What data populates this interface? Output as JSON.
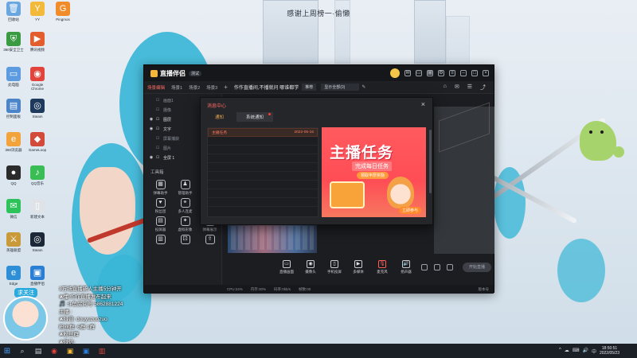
{
  "top_caption": "感谢上周榜一·偷懒",
  "desktop_icons": [
    {
      "label": "回收站",
      "glyph": "🗑",
      "color": "#6aa7e0"
    },
    {
      "label": "YY",
      "glyph": "Y",
      "color": "#f2b93b"
    },
    {
      "label": "Pingmos",
      "glyph": "G",
      "color": "#f28c2b"
    },
    {
      "label": "360安全卫士",
      "glyph": "⛨",
      "color": "#3b9b43"
    },
    {
      "label": "腾讯视频",
      "glyph": "▶",
      "color": "#e45d2f"
    },
    {
      "label": "此电脑",
      "glyph": "▭",
      "color": "#5c9be0"
    },
    {
      "label": "Google Chrome",
      "glyph": "◉",
      "color": "#e2433b"
    },
    {
      "label": "控制面板",
      "glyph": "▤",
      "color": "#4b84c8"
    },
    {
      "label": "Steam",
      "glyph": "◎",
      "color": "#1d3a5c"
    },
    {
      "label": "360浏览器",
      "glyph": "e",
      "color": "#f2a43a"
    },
    {
      "label": "GameLoop",
      "glyph": "◆",
      "color": "#d24a3a"
    },
    {
      "label": "QQ",
      "glyph": "●",
      "color": "#2b2b2b"
    },
    {
      "label": "QQ音乐",
      "glyph": "♪",
      "color": "#3bbd56"
    },
    {
      "label": "微信",
      "glyph": "✉",
      "color": "#2ec35a"
    },
    {
      "label": "新建文本",
      "glyph": "▯",
      "color": "#dfe3e8"
    },
    {
      "label": "英雄联盟",
      "glyph": "⚔",
      "color": "#c89a3a"
    },
    {
      "label": "Steam",
      "glyph": "◎",
      "color": "#1b2838"
    },
    {
      "label": "Edge",
      "glyph": "e",
      "color": "#2f8fd6"
    },
    {
      "label": "直播伴侣",
      "glyph": "▣",
      "color": "#2a7fd4"
    }
  ],
  "overlay": {
    "follow": "求关注",
    "lines": [
      "3万场直播新人主播5分钟开",
      "❀懂:作作直播发布起来",
      "🎵 斗鱼房间号 5862881224",
      "主播 :",
      "❀抖音: douyuzuozuo",
      "粉丝群: 6群 1群",
      "❀粉丝群",
      "❀微信:"
    ]
  },
  "app": {
    "name": "直播伴侣",
    "version": "测试",
    "scene_tabs": [
      "场景编辑",
      "场景1",
      "场景2",
      "场景3"
    ],
    "notice": "作作直播间,不播就问 哪谁都学",
    "tag": "推荐",
    "tag2": "显示全部(0)",
    "sources": [
      {
        "name": "画面1",
        "visible": false
      },
      {
        "name": "摄像",
        "visible": false
      },
      {
        "name": "图层",
        "visible": true
      },
      {
        "name": "文字",
        "visible": true
      },
      {
        "name": "屏幕捕获",
        "visible": false
      },
      {
        "name": "图片",
        "visible": false
      },
      {
        "name": "全屏 1",
        "visible": true
      }
    ],
    "tools_title": "工具箱",
    "tools": [
      {
        "icon": "▦",
        "label": "弹幕助手"
      },
      {
        "icon": "♟",
        "label": "管理助手"
      },
      {
        "icon": "",
        "label": ""
      },
      {
        "icon": "♥",
        "label": "粉丝团"
      },
      {
        "icon": "⚭",
        "label": "多人连麦"
      },
      {
        "icon": "☺",
        "label": "情绪背景"
      },
      {
        "icon": "▤",
        "label": "投屏器"
      },
      {
        "icon": "✦",
        "label": "虚拟形象"
      },
      {
        "icon": "▣",
        "label": "弹幕展示"
      },
      {
        "icon": "▥",
        "label": ""
      },
      {
        "icon": "⚀",
        "label": ""
      },
      {
        "icon": "⇪",
        "label": ""
      }
    ],
    "controls": [
      {
        "icon": "▭",
        "label": "直播画面"
      },
      {
        "icon": "◉",
        "label": "摄像头"
      },
      {
        "icon": "▯",
        "label": "手机投屏"
      },
      {
        "icon": "▶",
        "label": "多媒体"
      },
      {
        "icon": "🎙",
        "label": "麦克风"
      },
      {
        "icon": "🔊",
        "label": "扬声器"
      }
    ],
    "go_button": "开始直播",
    "status": [
      "CPU:24%",
      "内存:30%",
      "码率:0kb/s",
      "帧数:00"
    ],
    "status_version": "版本号"
  },
  "dialog": {
    "title": "消息中心",
    "tabs": [
      "通知",
      "系统通知"
    ],
    "message": {
      "title": "主播任务",
      "date": "2022-05-16"
    },
    "banner": {
      "title": "主播任务",
      "subtitle": "完成每日任务",
      "pill": "领取丰厚奖励",
      "button": "立即参与"
    }
  },
  "taskbar": {
    "apps": [
      {
        "glyph": "⌕",
        "color": "#cfd3d8"
      },
      {
        "glyph": "▤",
        "color": "#cfd3d8"
      },
      {
        "glyph": "◉",
        "color": "#e2433b"
      },
      {
        "glyph": "▣",
        "color": "#f2b93b"
      },
      {
        "glyph": "▣",
        "color": "#2a7fd4"
      },
      {
        "glyph": "▥",
        "color": "#d24a3a"
      }
    ],
    "tray": [
      "^",
      "☁",
      "⌨",
      "🔊",
      "中"
    ],
    "time": "18:50:51",
    "date": "2022/05/23"
  },
  "colors": {
    "accent": "#ff6b63",
    "app_bg": "#1c1d21",
    "taskbar": "#1b1f26"
  }
}
